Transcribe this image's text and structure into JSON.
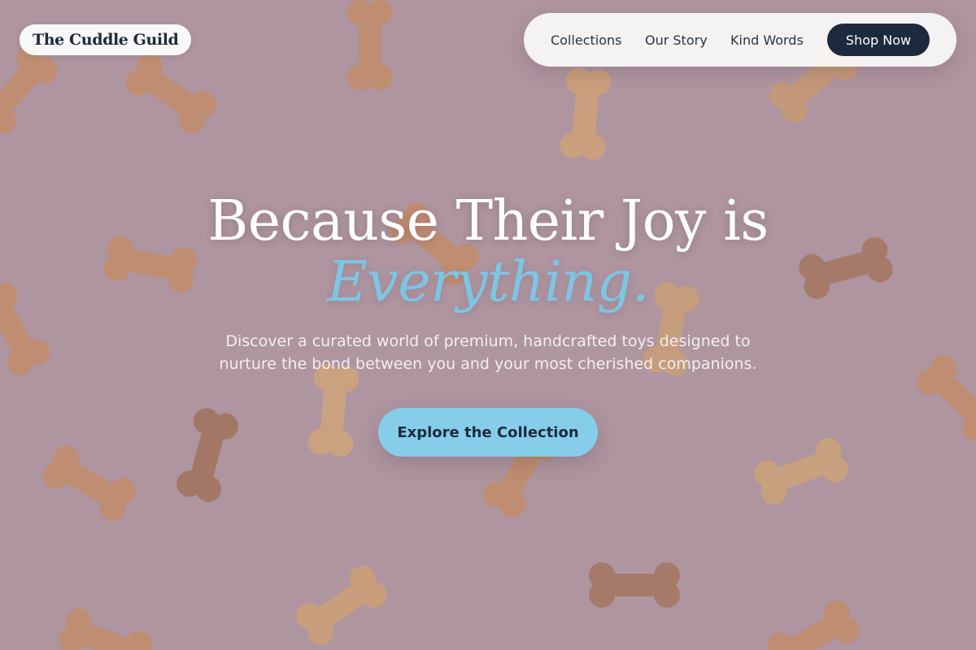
{
  "brand": {
    "name": "The Cuddle Guild"
  },
  "nav": {
    "links": [
      "Collections",
      "Our Story",
      "Kind Words"
    ],
    "cta_label": "Shop Now"
  },
  "hero": {
    "headline": "Because Their Joy is",
    "headline_accent": "Everything.",
    "subtitle_line1": "Discover a curated world of premium, handcrafted toys designed to",
    "subtitle_line2": "nurture the bond between you and your most cherished companions.",
    "cta_label": "Explore the Collection",
    "background_description_icon": "dog-bone-biscuits-image"
  },
  "colors": {
    "accent": "#7dc6e3",
    "cta_bg": "#86cde9",
    "dark": "#1d2a3d",
    "background": "#b49ba6"
  }
}
